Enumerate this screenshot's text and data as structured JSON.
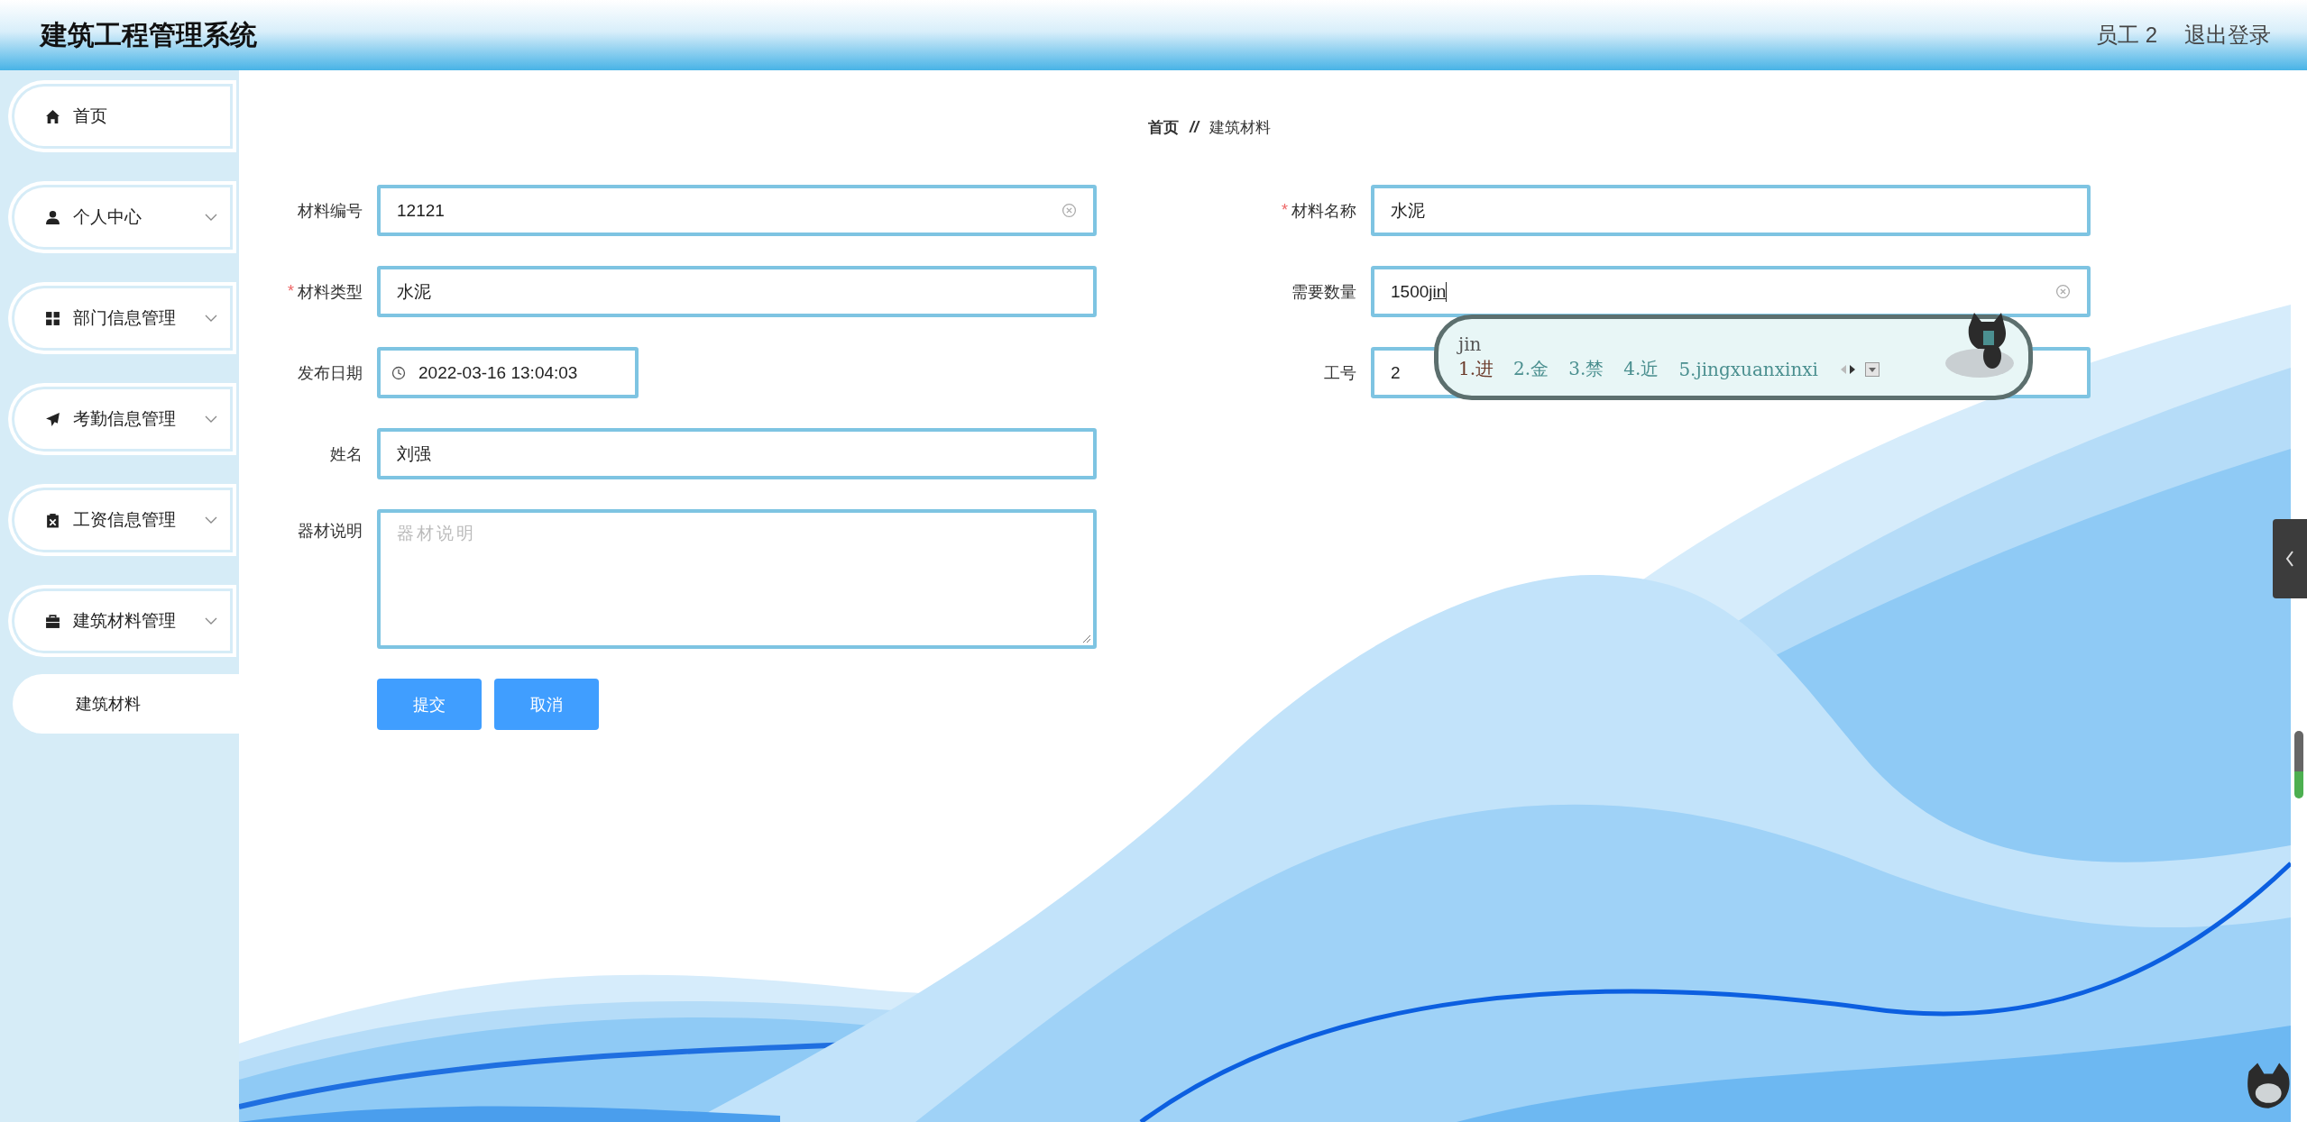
{
  "header": {
    "title": "建筑工程管理系统",
    "user": "员工 2",
    "logout": "退出登录"
  },
  "sidebar": {
    "items": [
      {
        "label": "首页",
        "kind": "link"
      },
      {
        "label": "个人中心",
        "kind": "menu"
      },
      {
        "label": "部门信息管理",
        "kind": "menu"
      },
      {
        "label": "考勤信息管理",
        "kind": "menu"
      },
      {
        "label": "工资信息管理",
        "kind": "menu"
      },
      {
        "label": "建筑材料管理",
        "kind": "menu",
        "children": [
          {
            "label": "建筑材料"
          }
        ]
      }
    ]
  },
  "breadcrumb": {
    "items": [
      "首页",
      "建筑材料"
    ],
    "separator": "//"
  },
  "form": {
    "left": [
      {
        "label": "材料编号",
        "kind": "text",
        "value": "12121",
        "clearable": true
      },
      {
        "required_mark": "*",
        "label": "材料类型",
        "kind": "text",
        "value": "水泥",
        "clearable": false
      },
      {
        "label": "发布日期",
        "kind": "date",
        "value": "2022-03-16 13:04:03",
        "clearable": false
      },
      {
        "label": "姓名",
        "kind": "text",
        "value": "刘强",
        "clearable": false
      },
      {
        "label": "器材说明",
        "kind": "textarea",
        "placeholder": "器材说明",
        "clearable": false
      }
    ],
    "right": [
      {
        "required_mark": "*",
        "label": "材料名称",
        "kind": "text",
        "value": "水泥",
        "clearable": false
      },
      {
        "label": "需要数量",
        "kind": "text",
        "value": "1500",
        "composition": "jin",
        "clearable": true
      },
      {
        "label": "工号",
        "kind": "text",
        "value": "2",
        "clearable": false
      }
    ],
    "buttons": [
      "提交",
      "取消"
    ]
  },
  "ime": {
    "input": "jin",
    "candidates": [
      {
        "text": "1.进",
        "selected": true
      },
      {
        "text": "2.金",
        "selected": false
      },
      {
        "text": "3.禁",
        "selected": false
      },
      {
        "text": "4.近",
        "selected": false
      },
      {
        "text": "5.jingxuanxinxi",
        "selected": false
      }
    ]
  }
}
